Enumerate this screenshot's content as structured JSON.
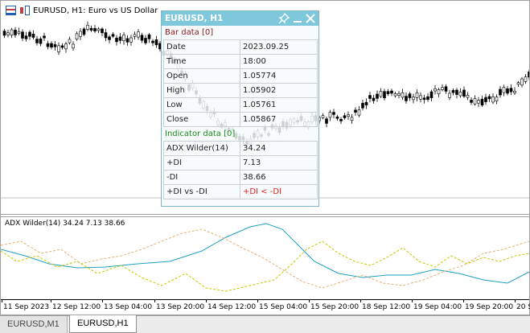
{
  "chart": {
    "symbol_title": "EURUSD, H1:  Euro vs US Dollar",
    "indicator_label": "ADX Wilder(14) 34.24 7.13 38.66",
    "time_labels": [
      "11 Sep 2023",
      "12 Sep 12:00",
      "13 Sep 04:00",
      "13 Sep 20:00",
      "14 Sep 12:00",
      "15 Sep 04:00",
      "15 Sep 20:00",
      "18 Sep 12:00",
      "19 Sep 04:00",
      "19 Sep 20:00",
      "20 Sep"
    ],
    "colors": {
      "adx": "#1fa0c0",
      "plus_di": "#c8c800",
      "minus_di": "#e8b070",
      "candle": "#000000"
    }
  },
  "panel": {
    "title": "EURUSD, H1",
    "bar_section": "Bar data [0]",
    "bar_rows": [
      {
        "key": "Date",
        "value": "2023.09.25"
      },
      {
        "key": "Time",
        "value": "18:00"
      },
      {
        "key": "Open",
        "value": "1.05774"
      },
      {
        "key": "High",
        "value": "1.05902"
      },
      {
        "key": "Low",
        "value": "1.05761"
      },
      {
        "key": "Close",
        "value": "1.05867"
      }
    ],
    "ind_section": "Indicator data [0]",
    "ind_rows": [
      {
        "key": "ADX Wilder(14)",
        "value": "34.24"
      },
      {
        "key": "+DI",
        "value": "7.13"
      },
      {
        "key": "-DI",
        "value": "38.66"
      },
      {
        "key": "+DI vs -DI",
        "value": "+DI < -DI"
      }
    ]
  },
  "tabs": [
    {
      "label": "EURUSD,M1",
      "active": false
    },
    {
      "label": "EURUSD,H1",
      "active": true
    }
  ]
}
